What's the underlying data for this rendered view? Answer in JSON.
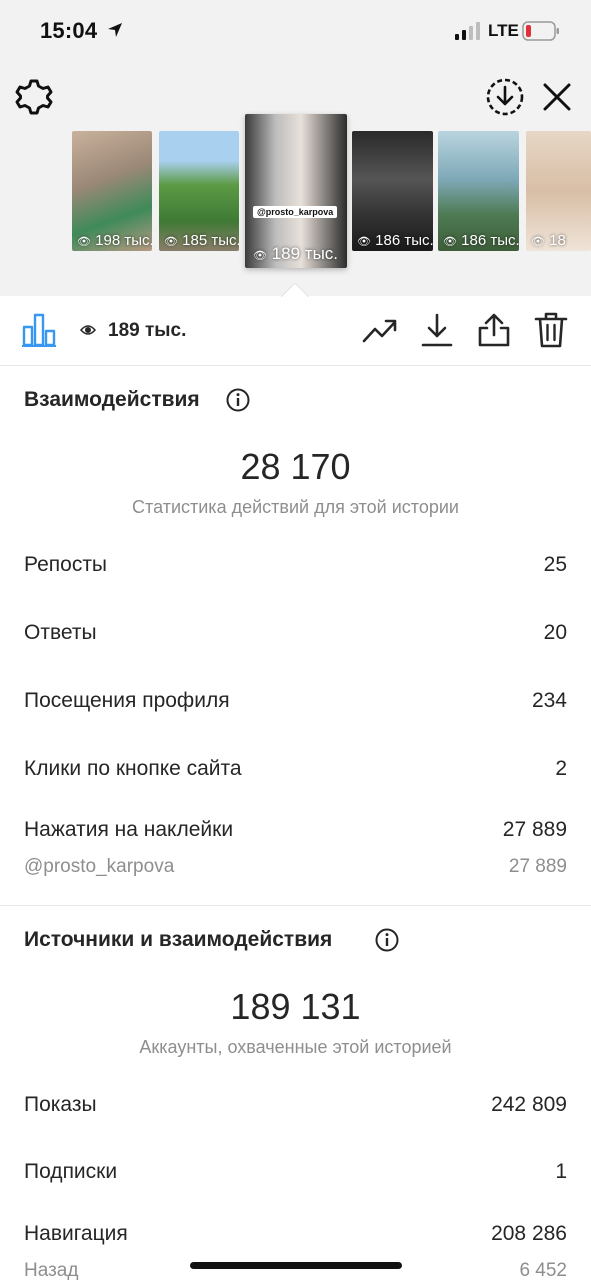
{
  "status_bar": {
    "time": "15:04",
    "network": "LTE",
    "battery_color": "#e0303a"
  },
  "header": {
    "settings_icon": "gear-icon",
    "save_icon": "download-circle-icon",
    "close_icon": "close-icon"
  },
  "stories": [
    {
      "views": "198 тыс.",
      "selected": false,
      "colors": [
        "#b89a82",
        "#3f8a5a"
      ]
    },
    {
      "views": "185 тыс.",
      "selected": false,
      "colors": [
        "#9ec4e8",
        "#4f8a3c"
      ]
    },
    {
      "views": "189 тыс.",
      "selected": true,
      "handle": "@prosto_karpova",
      "colors": [
        "#2a2a2a",
        "#c9c9c9"
      ]
    },
    {
      "views": "186 тыс.",
      "selected": false,
      "colors": [
        "#1c1c1c",
        "#555555"
      ]
    },
    {
      "views": "186 тыс.",
      "selected": false,
      "colors": [
        "#7fa9b8",
        "#3e5e3a"
      ]
    },
    {
      "views": "18",
      "selected": false,
      "colors": [
        "#d8c4b0",
        "#e8d7c4"
      ]
    }
  ],
  "toolbar": {
    "views": "189 тыс.",
    "icons": [
      "trend-icon",
      "download-icon",
      "share-icon",
      "trash-icon"
    ]
  },
  "interactions": {
    "title": "Взаимодействия",
    "total": "28 170",
    "caption": "Статистика действий для этой истории",
    "rows": [
      {
        "label": "Репосты",
        "value": "25"
      },
      {
        "label": "Ответы",
        "value": "20"
      },
      {
        "label": "Посещения профиля",
        "value": "234"
      },
      {
        "label": "Клики по кнопке сайта",
        "value": "2"
      },
      {
        "label": "Нажатия на наклейки",
        "value": "27 889"
      }
    ],
    "sticker_row": {
      "label": "@prosto_karpova",
      "value": "27 889"
    }
  },
  "discovery": {
    "title": "Источники и взаимодействия",
    "total": "189 131",
    "caption": "Аккаунты, охваченные этой историей",
    "rows": [
      {
        "label": "Показы",
        "value": "242 809"
      },
      {
        "label": "Подписки",
        "value": "1"
      },
      {
        "label": "Навигация",
        "value": "208 286"
      }
    ],
    "back_row": {
      "label": "Назад",
      "value": "6 452"
    }
  },
  "colors": {
    "accent": "#3897f0",
    "text": "#262626",
    "secondary": "#8e8e8e",
    "top_background": "#f2f2f2"
  }
}
